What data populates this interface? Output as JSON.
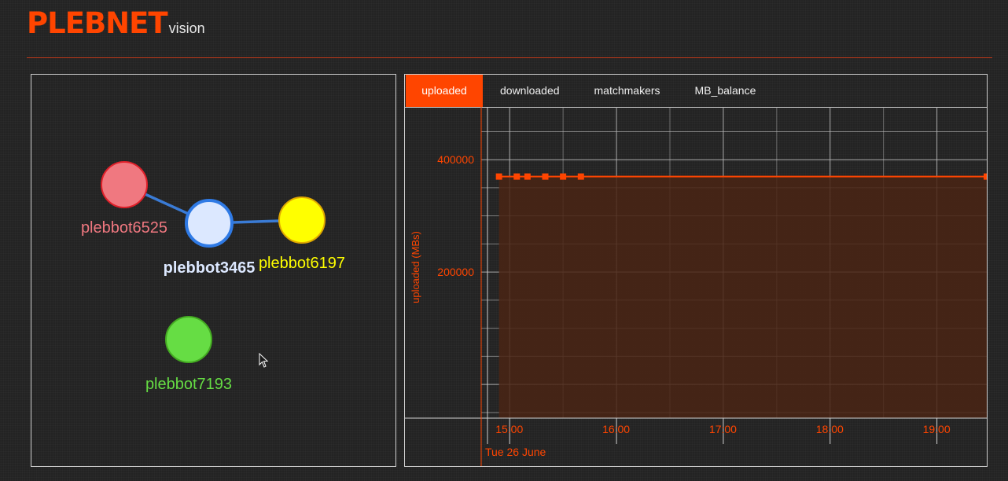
{
  "header": {
    "brand": "PLEBNET",
    "subtitle": "vision"
  },
  "colors": {
    "accent": "#ff4500",
    "edge": "#3a7bd5"
  },
  "network": {
    "nodes": [
      {
        "name": "plebbot6525",
        "color": "#f07880"
      },
      {
        "name": "plebbot3465",
        "color": "#dce8ff"
      },
      {
        "name": "plebbot6197",
        "color": "#ffff00"
      },
      {
        "name": "plebbot7193",
        "color": "#66dd44"
      }
    ],
    "links": [
      {
        "source": "plebbot6525",
        "target": "plebbot3465"
      },
      {
        "source": "plebbot3465",
        "target": "plebbot6197"
      }
    ]
  },
  "tabs": [
    {
      "label": "uploaded",
      "active": true
    },
    {
      "label": "downloaded",
      "active": false
    },
    {
      "label": "matchmakers",
      "active": false
    },
    {
      "label": "MB_balance",
      "active": false
    }
  ],
  "chart_data": {
    "type": "area",
    "ylabel": "uploaded (MBs)",
    "yticks": [
      "200000",
      "400000"
    ],
    "xticks": [
      "15:00",
      "16:00",
      "17:00",
      "18:00",
      "19:00"
    ],
    "date_label": "Tue 26 June",
    "series": [
      {
        "x": [
          "14:54",
          "15:04",
          "15:10",
          "15:20",
          "15:30",
          "15:40",
          "19:28"
        ],
        "values": [
          370000,
          370000,
          370000,
          370000,
          370000,
          370000,
          370000
        ]
      }
    ]
  }
}
